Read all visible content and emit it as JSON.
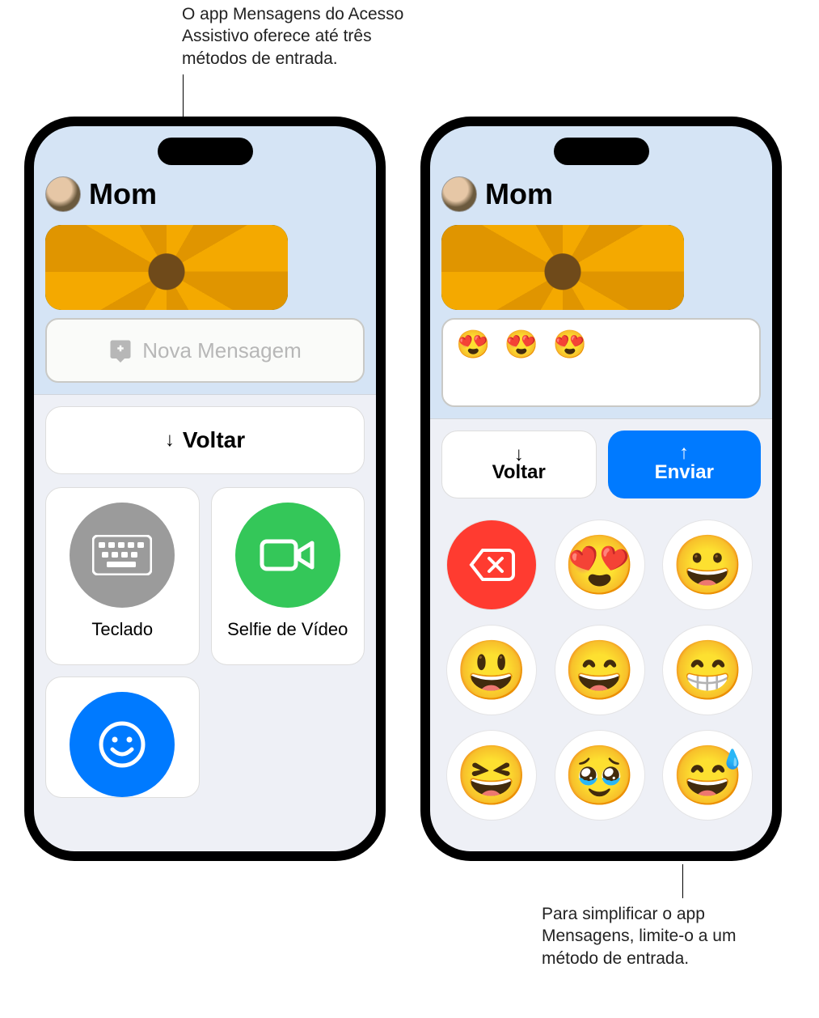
{
  "callouts": {
    "top": "O app Mensagens do Acesso Assistivo oferece até três métodos de entrada.",
    "bottom": "Para simplificar o app Mensagens, limite-o a um método de entrada."
  },
  "left_phone": {
    "contact_name": "Mom",
    "new_message_placeholder": "Nova Mensagem",
    "back_label": "Voltar",
    "tiles": {
      "keyboard": "Teclado",
      "video_selfie": "Selfie de Vídeo"
    }
  },
  "right_phone": {
    "contact_name": "Mom",
    "compose_text": "😍 😍 😍",
    "back_label": "Voltar",
    "send_label": "Enviar",
    "emoji_options": [
      "😍",
      "😀",
      "😃",
      "😄",
      "😁",
      "😆",
      "🥹",
      "😅"
    ]
  }
}
